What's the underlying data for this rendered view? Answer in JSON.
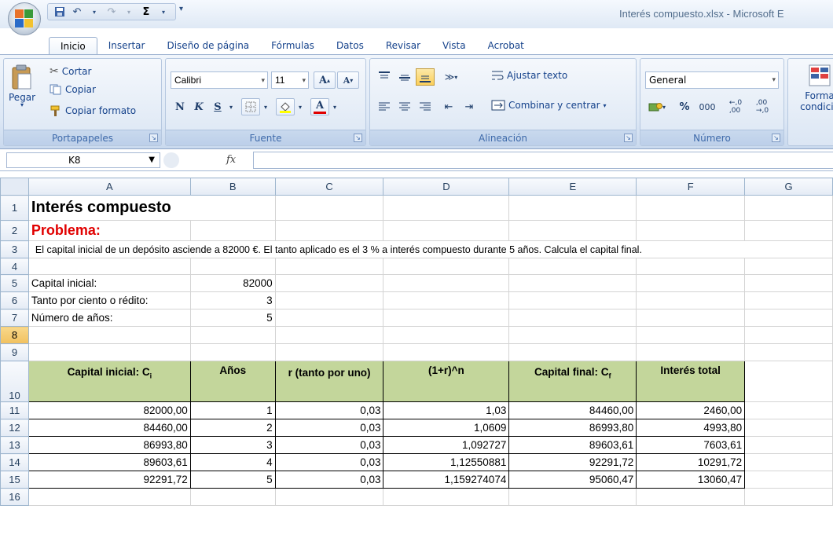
{
  "window": {
    "title": "Interés compuesto.xlsx - Microsoft E"
  },
  "quick_access": {
    "undo_label": "↶",
    "redo_label": "↷",
    "sum_label": "Σ",
    "more_label": "▾"
  },
  "tabs": [
    {
      "label": "Inicio",
      "active": true
    },
    {
      "label": "Insertar"
    },
    {
      "label": "Diseño de página"
    },
    {
      "label": "Fórmulas"
    },
    {
      "label": "Datos"
    },
    {
      "label": "Revisar"
    },
    {
      "label": "Vista"
    },
    {
      "label": "Acrobat"
    }
  ],
  "ribbon": {
    "portapapeles": {
      "label": "Portapapeles",
      "pegar": "Pegar",
      "cortar": "Cortar",
      "copiar": "Copiar",
      "copiar_formato": "Copiar formato"
    },
    "fuente": {
      "label": "Fuente",
      "font_name": "Calibri",
      "font_size": "11",
      "bold": "N",
      "italic": "K",
      "underline": "S",
      "grow": "A",
      "shrink": "A"
    },
    "alineacion": {
      "label": "Alineación",
      "ajustar_texto": "Ajustar texto",
      "combinar": "Combinar y centrar"
    },
    "numero": {
      "label": "Número",
      "format": "General",
      "percent": "%",
      "thousands": "000",
      "inc_decimals": "⁺,0 ,00",
      "dec_decimals": ",00 ,0"
    },
    "estilos": {
      "formato_condicional": "Forma condicio"
    }
  },
  "formula_bar": {
    "name_box": "K8",
    "fx": "fx",
    "value": ""
  },
  "sheet": {
    "columns": [
      "A",
      "B",
      "C",
      "D",
      "E",
      "F",
      "G"
    ],
    "rows": [
      "1",
      "2",
      "3",
      "4",
      "5",
      "6",
      "7",
      "8",
      "9",
      "10",
      "11",
      "12",
      "13",
      "14",
      "15",
      "16"
    ],
    "selected_row": "8",
    "a1": "Interés compuesto",
    "a2": "Problema:",
    "a3": "El capital inicial de un depósito asciende a 82000 €. El tanto aplicado es el 3 % a interés compuesto durante 5 años. Calcula el capital final.",
    "inputs": [
      {
        "label": "Capital inicial:",
        "value": "82000"
      },
      {
        "label": "Tanto por ciento o rédito:",
        "value": "3"
      },
      {
        "label": "Número de años:",
        "value": "5"
      }
    ],
    "headers": {
      "capital_inicial": "Capital inicial: C",
      "capital_inicial_sub": "i",
      "anos": "Años",
      "r": "r (tanto por uno)",
      "factor": "(1+r)^n",
      "capital_final": "Capital final: C",
      "capital_final_sub": "f",
      "interes_total": "Interés total"
    },
    "table_rows": [
      [
        "82000,00",
        "1",
        "0,03",
        "1,03",
        "84460,00",
        "2460,00"
      ],
      [
        "84460,00",
        "2",
        "0,03",
        "1,0609",
        "86993,80",
        "4993,80"
      ],
      [
        "86993,80",
        "3",
        "0,03",
        "1,092727",
        "89603,61",
        "7603,61"
      ],
      [
        "89603,61",
        "4",
        "0,03",
        "1,12550881",
        "92291,72",
        "10291,72"
      ],
      [
        "92291,72",
        "5",
        "0,03",
        "1,159274074",
        "95060,47",
        "13060,47"
      ]
    ]
  }
}
